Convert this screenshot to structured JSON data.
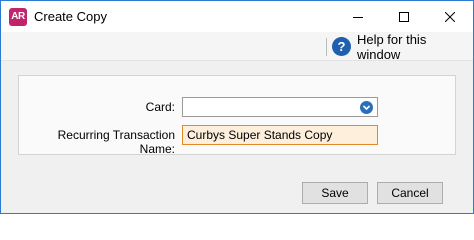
{
  "window": {
    "app_icon_text": "AR",
    "title": "Create Copy"
  },
  "toolbar": {
    "help_symbol": "?",
    "help_label": "Help for this window"
  },
  "form": {
    "card_label": "Card:",
    "card_value": "",
    "name_label": "Recurring Transaction Name:",
    "name_value": "Curbys Super Stands Copy"
  },
  "buttons": {
    "save_label": "Save",
    "cancel_label": "Cancel"
  },
  "colors": {
    "app_icon": "#c0246b",
    "help_icon": "#1f5fae",
    "field_highlight": "#fdefdc",
    "field_highlight_border": "#e08a2a"
  }
}
